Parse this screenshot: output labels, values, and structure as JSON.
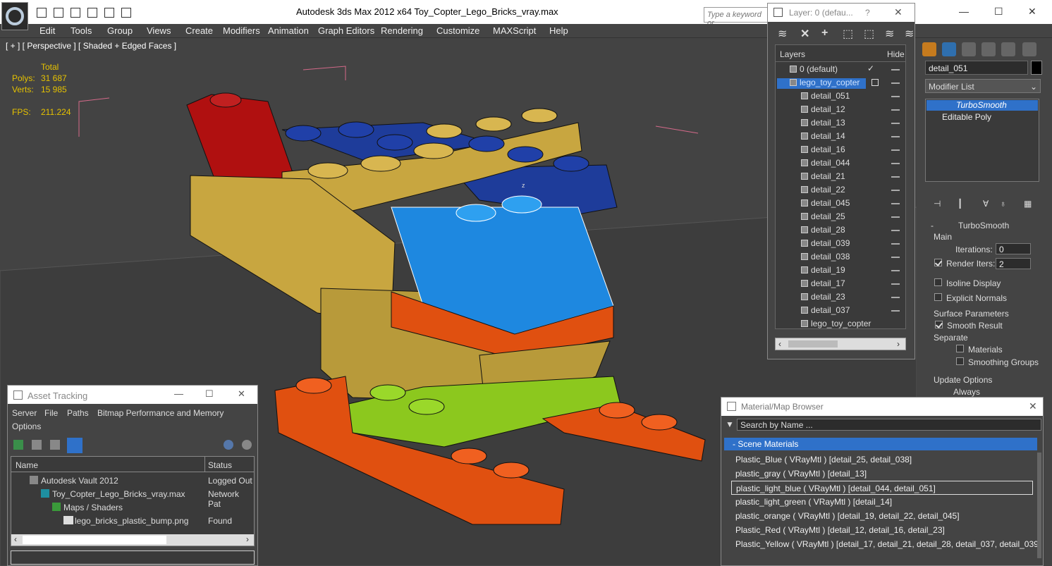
{
  "window": {
    "title": "Autodesk 3ds Max  2012 x64     Toy_Copter_Lego_Bricks_vray.max",
    "search_placeholder": "Type a keyword or"
  },
  "menu": [
    "Edit",
    "Tools",
    "Group",
    "Views",
    "Create",
    "Modifiers",
    "Animation",
    "Graph Editors",
    "Rendering",
    "Customize",
    "MAXScript",
    "Help"
  ],
  "viewport": {
    "label": "[ + ] [ Perspective ] [ Shaded + Edged Faces ]",
    "total_label": "Total",
    "polys_label": "Polys:",
    "polys": "31 687",
    "verts_label": "Verts:",
    "verts": "15 985",
    "fps_label": "FPS:",
    "fps": "211.224",
    "axis": "z"
  },
  "layers": {
    "title": "Layer: 0 (defau...",
    "help": "?",
    "col_layers": "Layers",
    "col_hide": "Hide",
    "rows": [
      "0 (default)",
      "lego_toy_copter",
      "detail_051",
      "detail_12",
      "detail_13",
      "detail_14",
      "detail_16",
      "detail_044",
      "detail_21",
      "detail_22",
      "detail_045",
      "detail_25",
      "detail_28",
      "detail_039",
      "detail_038",
      "detail_19",
      "detail_17",
      "detail_23",
      "detail_037",
      "lego_toy_copter"
    ]
  },
  "command_panel": {
    "name": "detail_051",
    "modifier_list": "Modifier List",
    "stack": [
      "TurboSmooth",
      "Editable Poly"
    ],
    "rollout": "TurboSmooth",
    "main": "Main",
    "iterations_label": "Iterations:",
    "iterations": "0",
    "render_iters_label": "Render Iters:",
    "render_iters": "2",
    "isoline": "Isoline Display",
    "explicit": "Explicit Normals",
    "surface": "Surface Parameters",
    "smooth_result": "Smooth Result",
    "separate": "Separate",
    "materials": "Materials",
    "smoothing_groups": "Smoothing Groups",
    "update": "Update Options",
    "always": "Always"
  },
  "asset": {
    "title": "Asset Tracking",
    "menu": [
      "Server",
      "File",
      "Paths",
      "Bitmap Performance and Memory",
      "Options"
    ],
    "col_name": "Name",
    "col_status": "Status",
    "rows": [
      {
        "name": "Autodesk Vault 2012",
        "status": "Logged Out"
      },
      {
        "name": "Toy_Copter_Lego_Bricks_vray.max",
        "status": "Network Pat"
      },
      {
        "name": "Maps / Shaders",
        "status": ""
      },
      {
        "name": "lego_bricks_plastic_bump.png",
        "status": "Found"
      }
    ]
  },
  "material": {
    "title": "Material/Map Browser",
    "search": "Search by Name ...",
    "section": "- Scene Materials",
    "rows": [
      "Plastic_Blue  ( VRayMtl )  [detail_25, detail_038]",
      "plastic_gray  ( VRayMtl )  [detail_13]",
      "plastic_light_blue  ( VRayMtl )  [detail_044, detail_051]",
      "plastic_light_green  ( VRayMtl )  [detail_14]",
      "plastic_orange  ( VRayMtl )  [detail_19, detail_22, detail_045]",
      "Plastic_Red  ( VRayMtl )  [detail_12, detail_16, detail_23]",
      "Plastic_Yellow  ( VRayMtl )  [detail_17, detail_21, detail_28, detail_037, detail_039]"
    ]
  },
  "colors": {
    "selection_blue": "#2f71c9",
    "stat_yellow": "#e6c200",
    "red": "#b01010",
    "yellow": "#c8a640",
    "blue": "#1e3c9a",
    "light_blue": "#1e88e0",
    "orange": "#e05010",
    "green": "#8cc81e"
  }
}
